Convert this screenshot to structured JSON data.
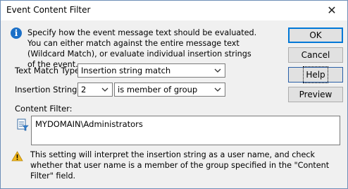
{
  "window": {
    "title": "Event Content Filter",
    "close_glyph": "✕"
  },
  "description": "Specify how the event message text should be evaluated. You can either match against the entire message text (Wildcard Match), or evaluate individual insertion strings of the event.",
  "buttons": {
    "ok": "OK",
    "cancel": "Cancel",
    "help": "Help",
    "preview": "Preview"
  },
  "text_match": {
    "label": "Text Match Type:",
    "value": "Insertion string match"
  },
  "insertion": {
    "label": "Insertion String:",
    "index_value": "2",
    "operator_value": "is member of group"
  },
  "content_filter": {
    "label": "Content Filter:",
    "value": "MYDOMAIN\\Administrators"
  },
  "warning": "This setting will interpret the insertion string as a user name, and check whether that user name is a member of the group specified in the \"Content Filter\" field.",
  "icons": {
    "info": "info-icon",
    "warning": "warning-icon",
    "filter": "filter-document-icon",
    "close": "close-icon",
    "dropdown": "chevron-down-icon"
  }
}
